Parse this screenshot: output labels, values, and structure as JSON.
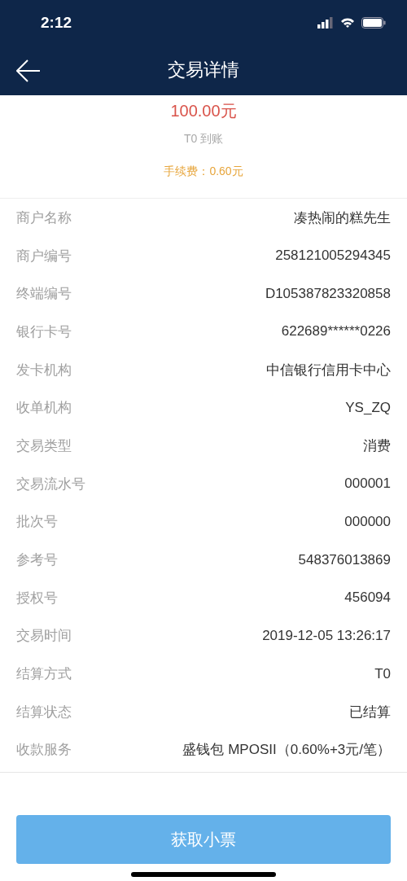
{
  "status_bar": {
    "time": "2:12"
  },
  "nav": {
    "title": "交易详情"
  },
  "summary": {
    "amount": "100.00元",
    "settlement": "T0 到账",
    "fee": "手续费：0.60元"
  },
  "details": [
    {
      "label": "商户名称",
      "value": "凑热闹的糕先生"
    },
    {
      "label": "商户编号",
      "value": "258121005294345"
    },
    {
      "label": "终端编号",
      "value": "D105387823320858"
    },
    {
      "label": "银行卡号",
      "value": "622689******0226"
    },
    {
      "label": "发卡机构",
      "value": "中信银行信用卡中心"
    },
    {
      "label": "收单机构",
      "value": "YS_ZQ"
    },
    {
      "label": "交易类型",
      "value": "消费"
    },
    {
      "label": "交易流水号",
      "value": "000001"
    },
    {
      "label": "批次号",
      "value": "000000"
    },
    {
      "label": "参考号",
      "value": "548376013869"
    },
    {
      "label": "授权号",
      "value": "456094"
    },
    {
      "label": "交易时间",
      "value": "2019-12-05 13:26:17"
    },
    {
      "label": "结算方式",
      "value": "T0"
    },
    {
      "label": "结算状态",
      "value": "已结算"
    },
    {
      "label": "收款服务",
      "value": "盛钱包 MPOSII（0.60%+3元/笔）"
    }
  ],
  "receipt_button": {
    "label": "获取小票"
  }
}
